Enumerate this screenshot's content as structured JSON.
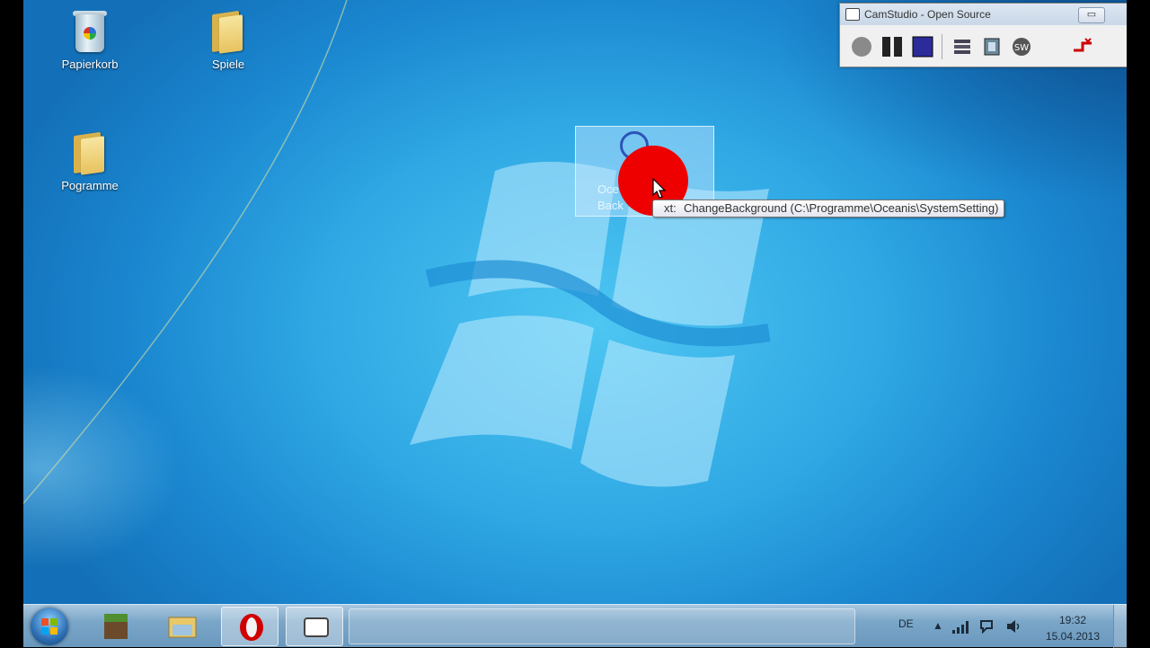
{
  "desktop": {
    "icons": [
      {
        "label": "Papierkorb",
        "icon": "recycle-bin-icon"
      },
      {
        "label": "Spiele",
        "icon": "folder-icon"
      },
      {
        "label": "Pogramme",
        "icon": "folder-icon"
      }
    ],
    "selected_icon": {
      "line1": "Oce",
      "line2": "Back",
      "icon": "oceanis-icon"
    },
    "tooltip": {
      "prefix": "xt:",
      "text": "ChangeBackground (C:\\Programme\\Oceanis\\SystemSetting)"
    }
  },
  "camstudio": {
    "title": "CamStudio - Open Source",
    "minimize_glyph": "▭",
    "tools": [
      "record-icon",
      "pause-icon",
      "stop-icon",
      "options-icon",
      "annotation-icon",
      "swf-icon",
      "exit-icon"
    ]
  },
  "taskbar": {
    "items": [
      "minecraft-icon",
      "explorer-icon",
      "opera-icon",
      "camstudio-icon"
    ],
    "tray": {
      "language": "DE"
    },
    "clock": {
      "time": "19:32",
      "date": "15.04.2013"
    }
  },
  "colors": {
    "desktop_blue": "#2fa8e4",
    "taskbar": "#7aa6c8",
    "red_dot": "#ee0000"
  }
}
